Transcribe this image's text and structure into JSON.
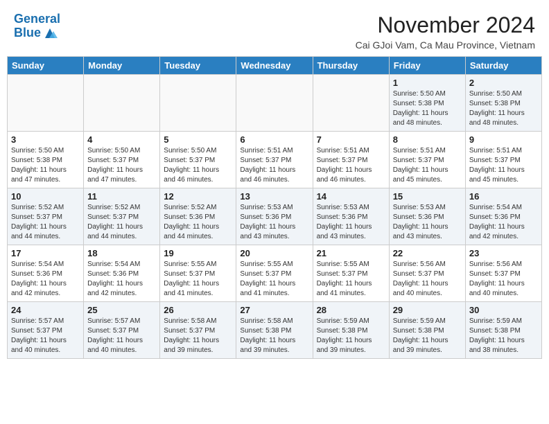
{
  "header": {
    "logo_line1": "General",
    "logo_line2": "Blue",
    "month_title": "November 2024",
    "location": "Cai GJoi Vam, Ca Mau Province, Vietnam"
  },
  "days_of_week": [
    "Sunday",
    "Monday",
    "Tuesday",
    "Wednesday",
    "Thursday",
    "Friday",
    "Saturday"
  ],
  "weeks": [
    [
      {
        "day": "",
        "info": ""
      },
      {
        "day": "",
        "info": ""
      },
      {
        "day": "",
        "info": ""
      },
      {
        "day": "",
        "info": ""
      },
      {
        "day": "",
        "info": ""
      },
      {
        "day": "1",
        "info": "Sunrise: 5:50 AM\nSunset: 5:38 PM\nDaylight: 11 hours\nand 48 minutes."
      },
      {
        "day": "2",
        "info": "Sunrise: 5:50 AM\nSunset: 5:38 PM\nDaylight: 11 hours\nand 48 minutes."
      }
    ],
    [
      {
        "day": "3",
        "info": "Sunrise: 5:50 AM\nSunset: 5:38 PM\nDaylight: 11 hours\nand 47 minutes."
      },
      {
        "day": "4",
        "info": "Sunrise: 5:50 AM\nSunset: 5:37 PM\nDaylight: 11 hours\nand 47 minutes."
      },
      {
        "day": "5",
        "info": "Sunrise: 5:50 AM\nSunset: 5:37 PM\nDaylight: 11 hours\nand 46 minutes."
      },
      {
        "day": "6",
        "info": "Sunrise: 5:51 AM\nSunset: 5:37 PM\nDaylight: 11 hours\nand 46 minutes."
      },
      {
        "day": "7",
        "info": "Sunrise: 5:51 AM\nSunset: 5:37 PM\nDaylight: 11 hours\nand 46 minutes."
      },
      {
        "day": "8",
        "info": "Sunrise: 5:51 AM\nSunset: 5:37 PM\nDaylight: 11 hours\nand 45 minutes."
      },
      {
        "day": "9",
        "info": "Sunrise: 5:51 AM\nSunset: 5:37 PM\nDaylight: 11 hours\nand 45 minutes."
      }
    ],
    [
      {
        "day": "10",
        "info": "Sunrise: 5:52 AM\nSunset: 5:37 PM\nDaylight: 11 hours\nand 44 minutes."
      },
      {
        "day": "11",
        "info": "Sunrise: 5:52 AM\nSunset: 5:37 PM\nDaylight: 11 hours\nand 44 minutes."
      },
      {
        "day": "12",
        "info": "Sunrise: 5:52 AM\nSunset: 5:36 PM\nDaylight: 11 hours\nand 44 minutes."
      },
      {
        "day": "13",
        "info": "Sunrise: 5:53 AM\nSunset: 5:36 PM\nDaylight: 11 hours\nand 43 minutes."
      },
      {
        "day": "14",
        "info": "Sunrise: 5:53 AM\nSunset: 5:36 PM\nDaylight: 11 hours\nand 43 minutes."
      },
      {
        "day": "15",
        "info": "Sunrise: 5:53 AM\nSunset: 5:36 PM\nDaylight: 11 hours\nand 43 minutes."
      },
      {
        "day": "16",
        "info": "Sunrise: 5:54 AM\nSunset: 5:36 PM\nDaylight: 11 hours\nand 42 minutes."
      }
    ],
    [
      {
        "day": "17",
        "info": "Sunrise: 5:54 AM\nSunset: 5:36 PM\nDaylight: 11 hours\nand 42 minutes."
      },
      {
        "day": "18",
        "info": "Sunrise: 5:54 AM\nSunset: 5:36 PM\nDaylight: 11 hours\nand 42 minutes."
      },
      {
        "day": "19",
        "info": "Sunrise: 5:55 AM\nSunset: 5:37 PM\nDaylight: 11 hours\nand 41 minutes."
      },
      {
        "day": "20",
        "info": "Sunrise: 5:55 AM\nSunset: 5:37 PM\nDaylight: 11 hours\nand 41 minutes."
      },
      {
        "day": "21",
        "info": "Sunrise: 5:55 AM\nSunset: 5:37 PM\nDaylight: 11 hours\nand 41 minutes."
      },
      {
        "day": "22",
        "info": "Sunrise: 5:56 AM\nSunset: 5:37 PM\nDaylight: 11 hours\nand 40 minutes."
      },
      {
        "day": "23",
        "info": "Sunrise: 5:56 AM\nSunset: 5:37 PM\nDaylight: 11 hours\nand 40 minutes."
      }
    ],
    [
      {
        "day": "24",
        "info": "Sunrise: 5:57 AM\nSunset: 5:37 PM\nDaylight: 11 hours\nand 40 minutes."
      },
      {
        "day": "25",
        "info": "Sunrise: 5:57 AM\nSunset: 5:37 PM\nDaylight: 11 hours\nand 40 minutes."
      },
      {
        "day": "26",
        "info": "Sunrise: 5:58 AM\nSunset: 5:37 PM\nDaylight: 11 hours\nand 39 minutes."
      },
      {
        "day": "27",
        "info": "Sunrise: 5:58 AM\nSunset: 5:38 PM\nDaylight: 11 hours\nand 39 minutes."
      },
      {
        "day": "28",
        "info": "Sunrise: 5:59 AM\nSunset: 5:38 PM\nDaylight: 11 hours\nand 39 minutes."
      },
      {
        "day": "29",
        "info": "Sunrise: 5:59 AM\nSunset: 5:38 PM\nDaylight: 11 hours\nand 39 minutes."
      },
      {
        "day": "30",
        "info": "Sunrise: 5:59 AM\nSunset: 5:38 PM\nDaylight: 11 hours\nand 38 minutes."
      }
    ]
  ]
}
